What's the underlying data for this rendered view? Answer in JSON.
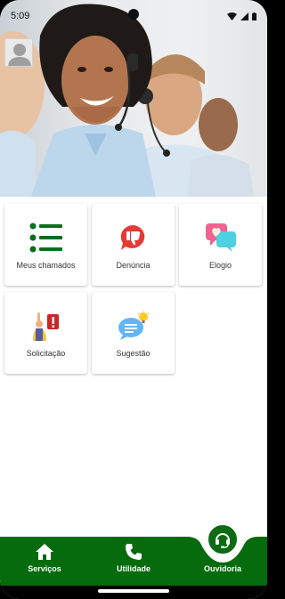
{
  "status_bar": {
    "time": "5:09"
  },
  "cards": [
    {
      "label": "Meus chamados",
      "icon": "list-icon"
    },
    {
      "label": "Denúncia",
      "icon": "thumbs-down-bubble-icon"
    },
    {
      "label": "Elogio",
      "icon": "heart-bubbles-icon"
    },
    {
      "label": "Solicitação",
      "icon": "raised-hand-alert-icon"
    },
    {
      "label": "Sugestão",
      "icon": "idea-bubble-icon"
    }
  ],
  "bottom_nav": {
    "items": [
      {
        "label": "Serviços",
        "icon": "home-icon"
      },
      {
        "label": "Utilidade",
        "icon": "phone-icon"
      },
      {
        "label": "Ouvidoria",
        "icon": "headset-icon"
      }
    ],
    "active": "Ouvidoria"
  },
  "colors": {
    "brand_green": "#056b0c",
    "card_bg": "#ffffff",
    "background": "#ffffff"
  }
}
